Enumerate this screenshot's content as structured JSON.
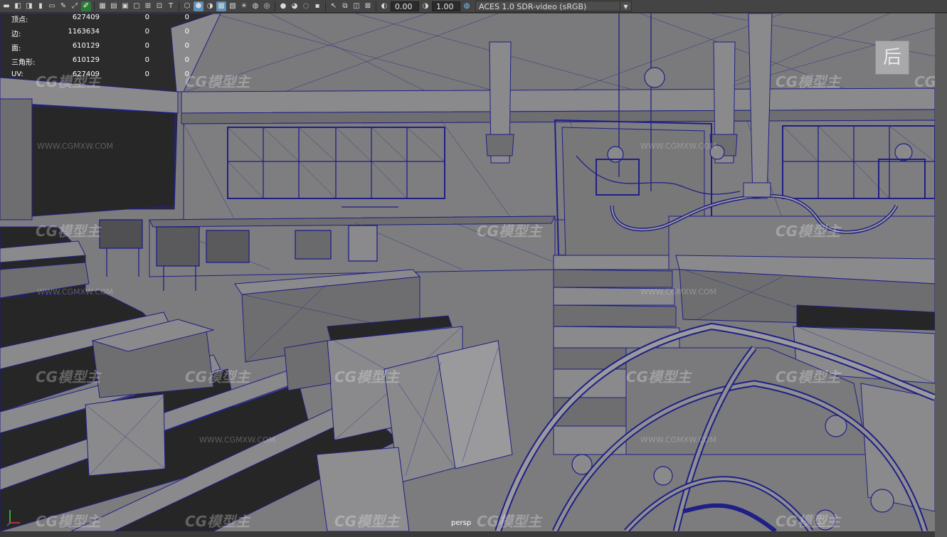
{
  "toolbar": {
    "icons": [
      "camera-icon",
      "camera-attr-icon",
      "bookmark-icon",
      "film-icon",
      "image-plane-icon",
      "grid-2d-icon",
      "grease-pencil-icon",
      "pan-zoom-icon",
      "grid-icon",
      "film-gate-icon",
      "resolution-gate-icon",
      "gate-mask-icon",
      "field-chart-icon",
      "safe-action-icon",
      "safe-title-icon",
      "wireframe-icon",
      "smooth-shade-icon",
      "bounding-box-icon",
      "textured-icon",
      "use-lights-icon",
      "shadows-icon",
      "screen-space-ao-icon",
      "motion-blur-icon",
      "anti-alias-icon",
      "depth-of-field-icon",
      "isolate-select-icon",
      "xray-icon",
      "xray-joints-icon",
      "backface-icon",
      "exposure-icon",
      "gamma-icon",
      "color-management-icon"
    ],
    "exposure_value": "0.00",
    "gamma_value": "1.00",
    "view_transform": "ACES 1.0 SDR-video (sRGB)"
  },
  "hud": {
    "rows": [
      {
        "label": "顶点:",
        "v1": "627409",
        "v2": "0",
        "v3": "0"
      },
      {
        "label": "边:",
        "v1": "1163634",
        "v2": "0",
        "v3": "0"
      },
      {
        "label": "面:",
        "v1": "610129",
        "v2": "0",
        "v3": "0"
      },
      {
        "label": "三角形:",
        "v1": "610129",
        "v2": "0",
        "v3": "0"
      },
      {
        "label": "UV:",
        "v1": "627409",
        "v2": "0",
        "v3": "0"
      }
    ]
  },
  "viewcube_label": "后",
  "camera_label": "persp",
  "watermark": {
    "brand": "CG模型主",
    "url": "WWW.CGMXW.COM"
  },
  "colors": {
    "wire": "#1f1f86",
    "viewport_bg": "#7c7c7e",
    "toolbar_bg": "#444444",
    "active_icon": "#5d8fb8"
  }
}
